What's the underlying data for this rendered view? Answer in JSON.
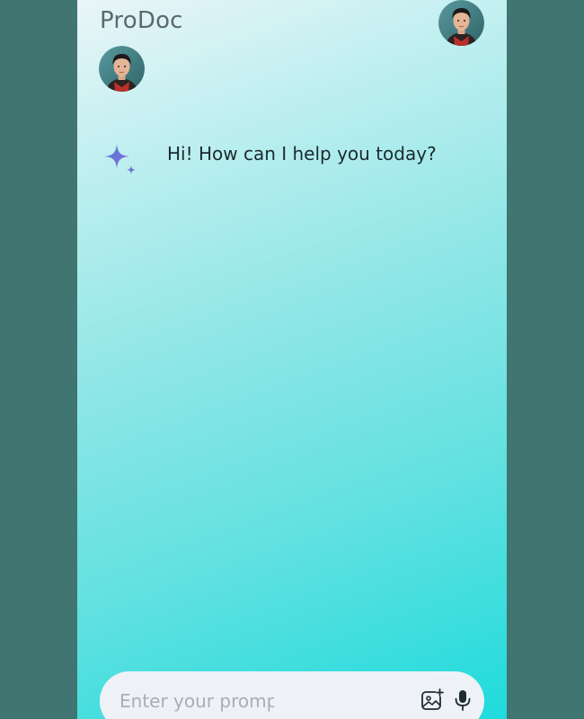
{
  "header": {
    "title": "ProDoc"
  },
  "chat": {
    "messages": [
      {
        "sender": "bot",
        "text": "Hi! How can I help you today?"
      }
    ]
  },
  "prompt": {
    "placeholder": "Enter your prompt",
    "value": ""
  },
  "icons": {
    "user_avatar": "user-avatar",
    "bot_icon": "sparkle-icon",
    "image_icon": "image-add-icon",
    "mic_icon": "microphone-icon"
  },
  "colors": {
    "page_background": "#417571",
    "gradient_start": "#eaf5f8",
    "gradient_end": "#1fdbdc",
    "prompt_bar": "#eef2f7",
    "sparkle_blue": "#4a7fd8",
    "sparkle_purple": "#8d67d6"
  }
}
